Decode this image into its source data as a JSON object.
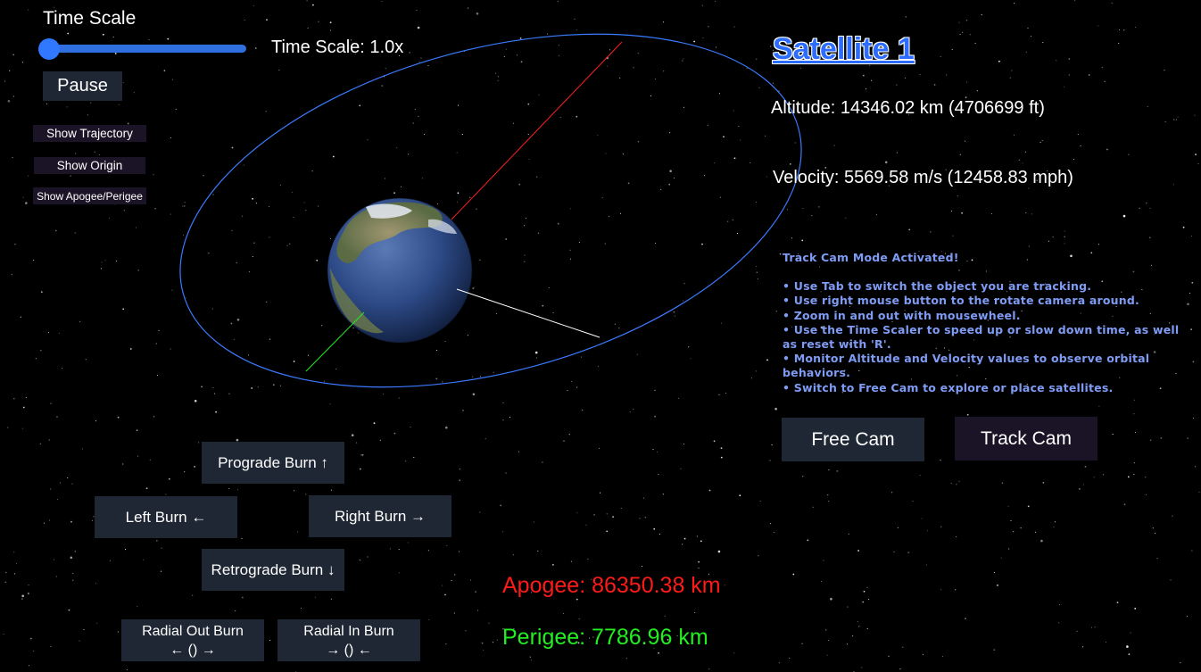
{
  "time_scale": {
    "title": "Time Scale",
    "value_label": "Time Scale: 1.0x",
    "slider_level": 0.0
  },
  "controls": {
    "pause_label": "Pause",
    "show_trajectory_label": "Show Trajectory",
    "show_origin_label": "Show Origin",
    "show_apsides_label": "Show Apogee/Perigee"
  },
  "satellite": {
    "name": "Satellite 1",
    "altitude": "Altitude: 14346.02 km (4706699 ft)",
    "velocity": "Velocity: 5569.58 m/s (12458.83 mph)"
  },
  "help": {
    "heading": "Track Cam Mode Activated!",
    "tips": [
      "• Use Tab to switch the object you are tracking.",
      "• Use right mouse button to the rotate camera around.",
      "• Zoom in and out with mousewheel.",
      "• Use the Time Scaler to speed up or slow down time, as well as reset with 'R'.",
      "• Monitor Altitude and Velocity values to observe orbital behaviors.",
      "• Switch to Free Cam to explore or place satellites."
    ]
  },
  "camera": {
    "free_label": "Free Cam",
    "track_label": "Track Cam"
  },
  "burns": {
    "prograde": "Prograde Burn ↑",
    "left": "Left Burn ←",
    "right": "Right Burn →",
    "retrograde": "Retrograde Burn ↓",
    "radial_out_line1": "Radial Out Burn",
    "radial_out_line2": "← () →",
    "radial_in_line1": "Radial In Burn",
    "radial_in_line2": "→ () ←"
  },
  "orbit": {
    "apogee": "Apogee: 86350.38 km",
    "perigee": "Perigee: 7786.96 km"
  },
  "colors": {
    "orbit": "#3b7bff",
    "apogee": "#ff1a1a",
    "perigee": "#22ee22",
    "velocity_vector": "#ffffff",
    "help_text": "#7f9cf5"
  }
}
